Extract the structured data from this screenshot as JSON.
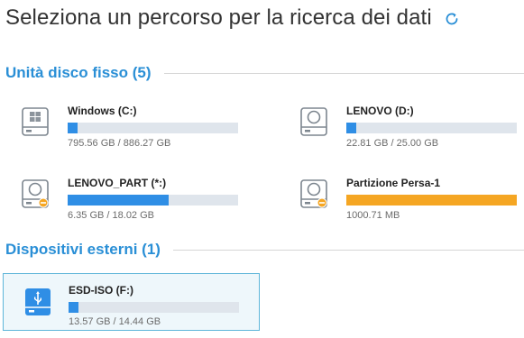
{
  "title": "Seleziona un percorso per la ricerca dei dati",
  "sections": {
    "fixed": {
      "label": "Unità disco fisso (5)",
      "drives": [
        {
          "name": "Windows (C:)",
          "size": "795.56 GB / 886.27 GB",
          "usage_fraction": 0.06,
          "icon": "windows-disk-icon",
          "bar_color": "#2f8ee5"
        },
        {
          "name": "LENOVO (D:)",
          "size": "22.81 GB / 25.00 GB",
          "usage_fraction": 0.06,
          "icon": "hard-disk-icon",
          "bar_color": "#2f8ee5"
        },
        {
          "name": "LENOVO_PART (*:)",
          "size": "6.35 GB / 18.02 GB",
          "usage_fraction": 0.59,
          "icon": "hard-disk-warning-icon",
          "bar_color": "#2f8ee5"
        },
        {
          "name": "Partizione Persa-1",
          "size": "1000.71 MB",
          "usage_fraction": 1.0,
          "icon": "hard-disk-warning-icon",
          "bar_color": "#f5a623"
        }
      ]
    },
    "external": {
      "label": "Dispositivi esterni (1)",
      "drives": [
        {
          "name": "ESD-ISO (F:)",
          "size": "13.57 GB / 14.44 GB",
          "usage_fraction": 0.06,
          "icon": "usb-drive-icon",
          "bar_color": "#2f8ee5",
          "selected": true
        }
      ]
    }
  },
  "colors": {
    "accent": "#2a8fd6",
    "bar_used": "#2f8ee5",
    "bar_lost": "#f5a623",
    "bar_track": "#dfe5ec",
    "selected_bg": "#eef7fb",
    "selected_border": "#5fb6d9"
  }
}
